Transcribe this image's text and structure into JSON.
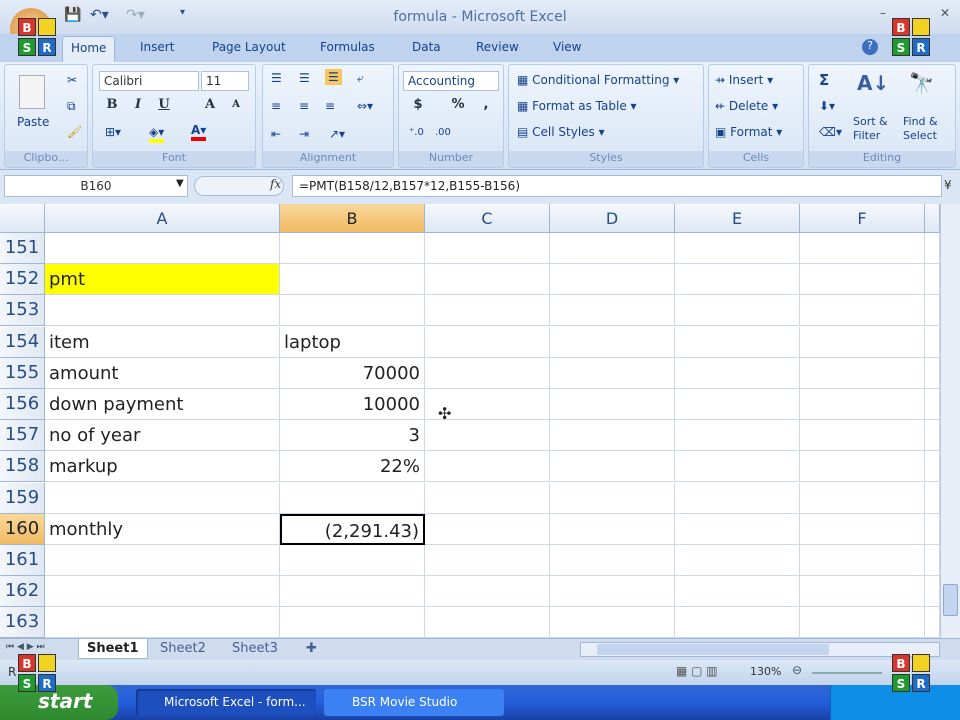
{
  "window": {
    "title": "formula - Microsoft Excel"
  },
  "tabs": [
    "Home",
    "Insert",
    "Page Layout",
    "Formulas",
    "Data",
    "Review",
    "View"
  ],
  "ribbon": {
    "clipboard": {
      "label": "Clipbo...",
      "paste": "Paste"
    },
    "font": {
      "label": "Font",
      "name": "Calibri",
      "size": "11",
      "bold": "B",
      "italic": "I",
      "underline": "U",
      "grow": "A",
      "shrink": "A"
    },
    "alignment": {
      "label": "Alignment"
    },
    "number": {
      "label": "Number",
      "format": "Accounting",
      "currency": "$",
      "percent": "%",
      "comma": ","
    },
    "styles": {
      "label": "Styles",
      "conditional": "Conditional Formatting",
      "table": "Format as Table",
      "cell": "Cell Styles"
    },
    "cells": {
      "label": "Cells",
      "insert": "Insert",
      "delete": "Delete",
      "format": "Format"
    },
    "editing": {
      "label": "Editing",
      "sum": "Σ",
      "sort": "Sort & Filter",
      "find": "Find & Select"
    }
  },
  "formula_bar": {
    "name_box": "B160",
    "fx": "fx",
    "formula": "=PMT(B158/12,B157*12,B155-B156)"
  },
  "columns": [
    "A",
    "B",
    "C",
    "D",
    "E",
    "F"
  ],
  "selected_column": "B",
  "rows": [
    {
      "n": "151",
      "a": "",
      "b": ""
    },
    {
      "n": "152",
      "a": "pmt",
      "b": "",
      "highlight": "#ffff00"
    },
    {
      "n": "153",
      "a": "",
      "b": ""
    },
    {
      "n": "154",
      "a": "item",
      "b": "laptop",
      "b_align": "left"
    },
    {
      "n": "155",
      "a": "amount",
      "b": "70000"
    },
    {
      "n": "156",
      "a": "down payment",
      "b": "10000"
    },
    {
      "n": "157",
      "a": "no of year",
      "b": "3"
    },
    {
      "n": "158",
      "a": "markup",
      "b": "22%"
    },
    {
      "n": "159",
      "a": "",
      "b": ""
    },
    {
      "n": "160",
      "a": "monthly",
      "b": "(2,291.43)",
      "selected": true
    },
    {
      "n": "161",
      "a": "",
      "b": ""
    },
    {
      "n": "162",
      "a": "",
      "b": ""
    },
    {
      "n": "163",
      "a": "",
      "b": ""
    }
  ],
  "sheets": [
    "Sheet1",
    "Sheet2",
    "Sheet3"
  ],
  "status": {
    "ready": "R",
    "zoom": "130%"
  },
  "taskbar": {
    "start": "start",
    "items": [
      "Microsoft Excel - form...",
      "BSR Movie Studio"
    ]
  },
  "logo": {
    "letters": [
      "B",
      "",
      "S",
      "R"
    ]
  }
}
